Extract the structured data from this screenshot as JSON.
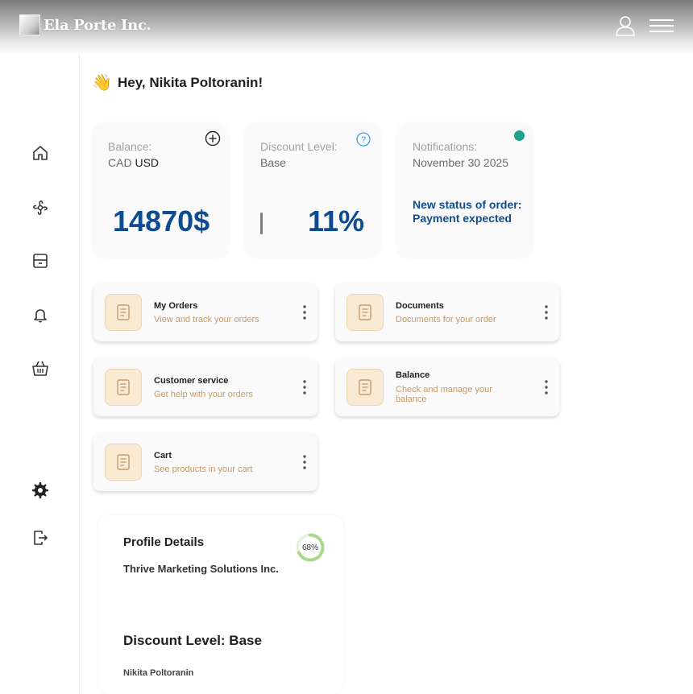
{
  "header": {
    "brand": "Ela Porte Inc.",
    "icons": [
      "user-icon",
      "hamburger-menu-icon"
    ]
  },
  "sidebar": {
    "items": [
      {
        "name": "home",
        "icon": "home-icon"
      },
      {
        "name": "products",
        "icon": "propeller-icon"
      },
      {
        "name": "orders",
        "icon": "box-icon"
      },
      {
        "name": "notifications",
        "icon": "bell-icon"
      },
      {
        "name": "cart",
        "icon": "basket-icon"
      }
    ],
    "bottom_items": [
      {
        "name": "settings",
        "icon": "gear-icon"
      },
      {
        "name": "logout",
        "icon": "logout-icon"
      }
    ]
  },
  "greeting": {
    "emoji": "👋",
    "text": "Hey, Nikita Poltoranin!"
  },
  "stats": {
    "balance": {
      "label": "Balance:",
      "currency_prefix": "CAD",
      "currency": "USD",
      "amount": "14870$",
      "icon": "plus-circle-icon"
    },
    "discount": {
      "label": "Discount Level:",
      "level": "Base",
      "value": "11%",
      "icon": "help-circle-icon"
    },
    "notifications": {
      "label": "Notifications:",
      "date": "November 30 2025",
      "message": "New status of order: Payment expected",
      "status_color": "#21a08a"
    }
  },
  "actions": [
    {
      "title": "My Orders",
      "desc": "View and track your orders",
      "icon": "document-icon"
    },
    {
      "title": "Documents",
      "desc": "Documents for your order",
      "icon": "document-icon"
    },
    {
      "title": "Customer service",
      "desc": "Get help with your orders",
      "icon": "document-icon"
    },
    {
      "title": "Balance",
      "desc": "Check and manage your balance",
      "icon": "document-icon"
    },
    {
      "title": "Cart",
      "desc": "See products in your cart",
      "icon": "document-icon"
    }
  ],
  "profile": {
    "title": "Profile Details",
    "company": "Thrive Marketing Solutions Inc.",
    "completion": "68%",
    "completion_value": 0.68,
    "discount_heading": "Discount Level: Base",
    "name": "Nikita Poltoranin"
  },
  "colors": {
    "accent_blue": "#0f4c8f",
    "tile_bg": "#f9ead3",
    "tile_text": "#c49a6c",
    "ring": "#a9d98a"
  }
}
